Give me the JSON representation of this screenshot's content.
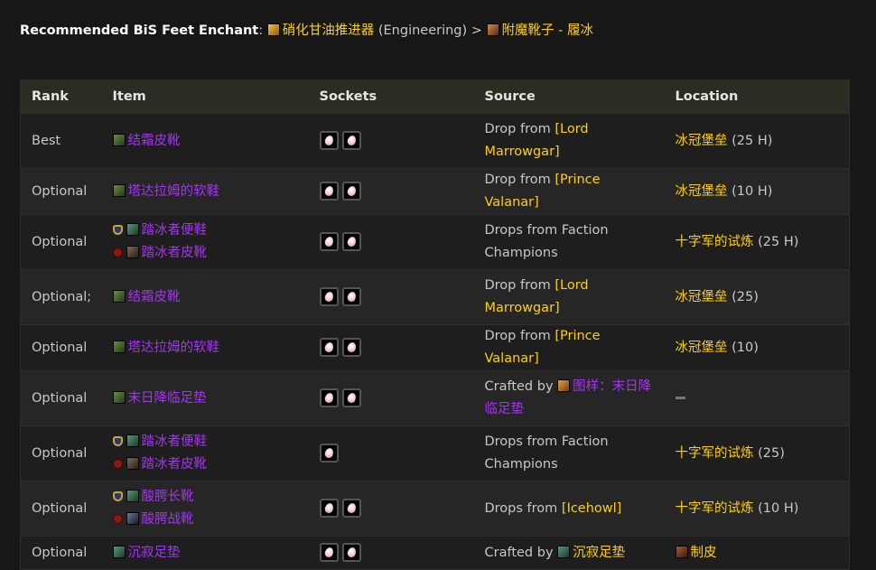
{
  "header": {
    "label": "Recommended BiS Feet Enchant",
    "colon": ":",
    "enchant_name": "硝化甘油推进器",
    "profession": "(Engineering)",
    "arrow": ">",
    "alt_enchant": "附魔靴子 - 履冰"
  },
  "table": {
    "columns": [
      "Rank",
      "Item",
      "Sockets",
      "Source",
      "Location"
    ],
    "rows": [
      {
        "rank": "Best",
        "items": [
          {
            "name": "结霜皮靴",
            "icon": "boot-green-icon"
          }
        ],
        "sockets": 2,
        "source_prefix": "Drop from ",
        "source_link": "[Lord Marrowgar]",
        "source_color": "gold",
        "location_link": "冰冠堡垒",
        "location_suffix": " (25 H)"
      },
      {
        "rank": "Optional",
        "items": [
          {
            "name": "塔达拉姆的软鞋",
            "icon": "boot-green-icon"
          }
        ],
        "sockets": 2,
        "source_prefix": "Drop from ",
        "source_link": "[Prince Valanar]",
        "source_color": "gold",
        "location_link": "冰冠堡垒",
        "location_suffix": " (10 H)"
      },
      {
        "rank": "Optional",
        "items": [
          {
            "name": "踏冰者便鞋",
            "icon": "boot-teal-icon",
            "faction": "alliance"
          },
          {
            "name": "踏冰者皮靴",
            "icon": "boot-purple-icon",
            "faction": "horde"
          }
        ],
        "sockets": 2,
        "source_prefix": "Drops from Faction Champions",
        "source_link": "",
        "source_color": "gold",
        "location_link": "十字军的试炼",
        "location_suffix": " (25 H)"
      },
      {
        "rank": "Optional;",
        "items": [
          {
            "name": "结霜皮靴",
            "icon": "boot-green-icon"
          }
        ],
        "sockets": 2,
        "source_prefix": "Drop from ",
        "source_link": "[Lord Marrowgar]",
        "source_color": "gold",
        "location_link": "冰冠堡垒",
        "location_suffix": " (25)"
      },
      {
        "rank": "Optional",
        "items": [
          {
            "name": "塔达拉姆的软鞋",
            "icon": "boot-green-icon"
          }
        ],
        "sockets": 2,
        "source_prefix": "Drop from ",
        "source_link": "[Prince Valanar]",
        "source_color": "gold",
        "location_link": "冰冠堡垒",
        "location_suffix": " (10)"
      },
      {
        "rank": "Optional",
        "items": [
          {
            "name": "末日降临足垫",
            "icon": "boot-green-icon"
          }
        ],
        "sockets": 2,
        "source_prefix": "Crafted by ",
        "source_link": "图样：末日降临足垫",
        "source_color": "purple",
        "source_icon": "recipe-icon",
        "location_link": "",
        "location_suffix": "",
        "location_dash": true
      },
      {
        "rank": "Optional",
        "items": [
          {
            "name": "踏冰者便鞋",
            "icon": "boot-teal-icon",
            "faction": "alliance"
          },
          {
            "name": "踏冰者皮靴",
            "icon": "boot-purple-icon",
            "faction": "horde"
          }
        ],
        "sockets": 1,
        "source_prefix": "Drops from Faction Champions",
        "source_link": "",
        "source_color": "gold",
        "location_link": "十字军的试炼",
        "location_suffix": " (25)"
      },
      {
        "rank": "Optional",
        "items": [
          {
            "name": "酸腭长靴",
            "icon": "boot-teal-icon",
            "faction": "alliance"
          },
          {
            "name": "酸腭战靴",
            "icon": "boot-blue-icon",
            "faction": "horde"
          }
        ],
        "sockets": 2,
        "source_prefix": "Drops from ",
        "source_link": "[Icehowl]",
        "source_color": "gold",
        "location_link": "十字军的试炼",
        "location_suffix": " (10 H)"
      },
      {
        "rank": "Optional",
        "items": [
          {
            "name": "沉寂足垫",
            "icon": "boot-teal-icon"
          }
        ],
        "sockets": 2,
        "source_prefix": "Crafted by ",
        "source_link": "沉寂足垫",
        "source_color": "gold",
        "source_icon": "boot-teal-icon",
        "location_link": "制皮",
        "location_suffix": "",
        "location_icon": "hide-icon"
      }
    ]
  },
  "colors": {
    "gold": "#ffd100",
    "purple": "#a335ee",
    "background": "#171717",
    "header_bg": "#2c2c22"
  }
}
